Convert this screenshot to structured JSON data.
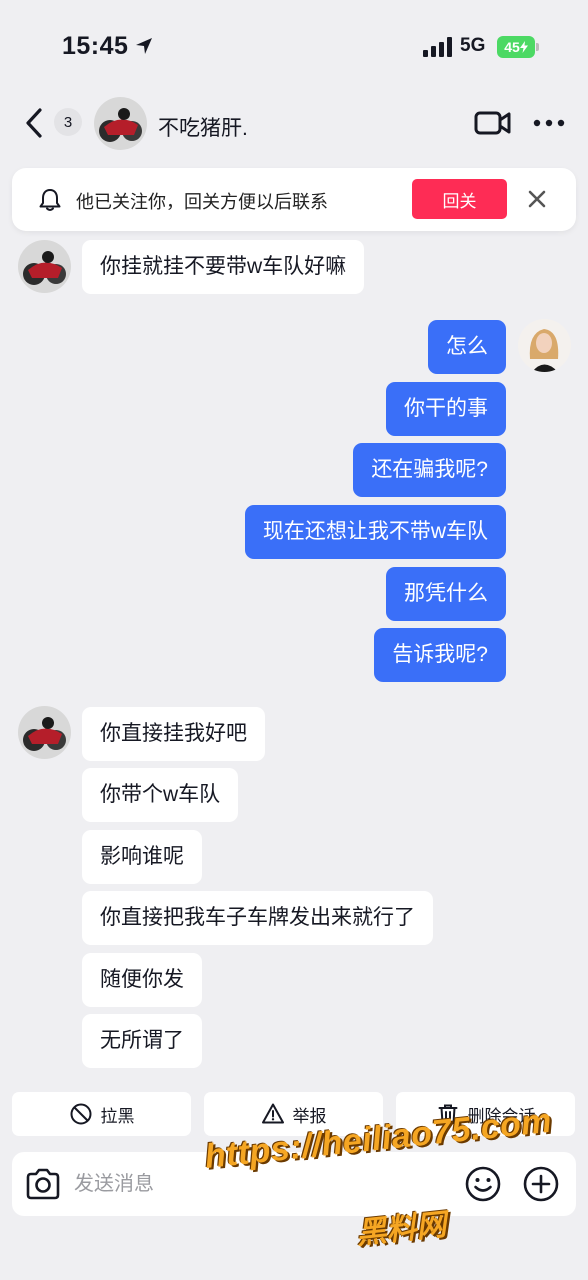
{
  "status_bar": {
    "time": "15:45",
    "network": "5G",
    "battery": "45"
  },
  "header": {
    "unread_count": "3",
    "contact_name": "不吃猪肝."
  },
  "follow_banner": {
    "text": "他已关注你，回关方便以后联系",
    "button": "回关"
  },
  "messages": [
    {
      "side": "in",
      "text": "你挂就挂不要带w车队好嘛"
    },
    {
      "side": "out",
      "text": "怎么"
    },
    {
      "side": "out",
      "text": "你干的事"
    },
    {
      "side": "out",
      "text": "还在骗我呢?"
    },
    {
      "side": "out",
      "text": "现在还想让我不带w车队"
    },
    {
      "side": "out",
      "text": "那凭什么"
    },
    {
      "side": "out",
      "text": "告诉我呢?"
    },
    {
      "side": "in",
      "text": "你直接挂我好吧"
    },
    {
      "side": "in",
      "text": "你带个w车队"
    },
    {
      "side": "in",
      "text": "影响谁呢"
    },
    {
      "side": "in",
      "text": "你直接把我车子车牌发出来就行了"
    },
    {
      "side": "in",
      "text": "随便你发"
    },
    {
      "side": "in",
      "text": "无所谓了"
    }
  ],
  "actions": {
    "block": "拉黑",
    "report": "举报",
    "delete": "删除会话"
  },
  "input": {
    "placeholder": "发送消息"
  },
  "watermark": {
    "url": "https://heiliao75.com",
    "name": "黑料网"
  },
  "colors": {
    "accent_blue": "#3a6ff8",
    "follow_red": "#fe2c55",
    "background": "#efeff2",
    "battery_green": "#4cd964"
  }
}
